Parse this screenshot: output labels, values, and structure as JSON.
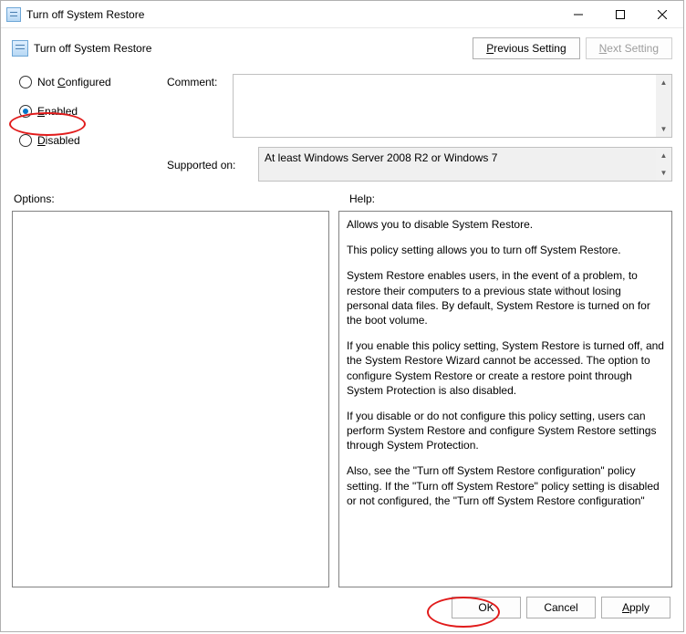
{
  "window": {
    "title": "Turn off System Restore"
  },
  "header": {
    "title": "Turn off System Restore",
    "buttons": {
      "previous": "Previous Setting",
      "next": "Next Setting"
    }
  },
  "radios": {
    "not_configured": "Not Configured",
    "enabled": "Enabled",
    "disabled": "Disabled",
    "selected": "enabled"
  },
  "comment": {
    "label": "Comment:",
    "value": ""
  },
  "supported": {
    "label": "Supported on:",
    "value": "At least Windows Server 2008 R2 or Windows 7"
  },
  "sections": {
    "options": "Options:",
    "help": "Help:"
  },
  "help_paras": {
    "p1": "Allows you to disable System Restore.",
    "p2": "This policy setting allows you to turn off System Restore.",
    "p3": "System Restore enables users, in the event of a problem, to restore their computers to a previous state without losing personal data files. By default, System Restore is turned on for the boot volume.",
    "p4": "If you enable this policy setting, System Restore is turned off, and the System Restore Wizard cannot be accessed. The option to configure System Restore or create a restore point through System Protection is also disabled.",
    "p5": "If you disable or do not configure this policy setting, users can perform System Restore and configure System Restore settings through System Protection.",
    "p6": "Also, see the \"Turn off System Restore configuration\" policy setting. If the \"Turn off System Restore\" policy setting is disabled or not configured, the \"Turn off System Restore configuration\""
  },
  "buttons": {
    "ok": "OK",
    "cancel": "Cancel",
    "apply": "Apply"
  }
}
